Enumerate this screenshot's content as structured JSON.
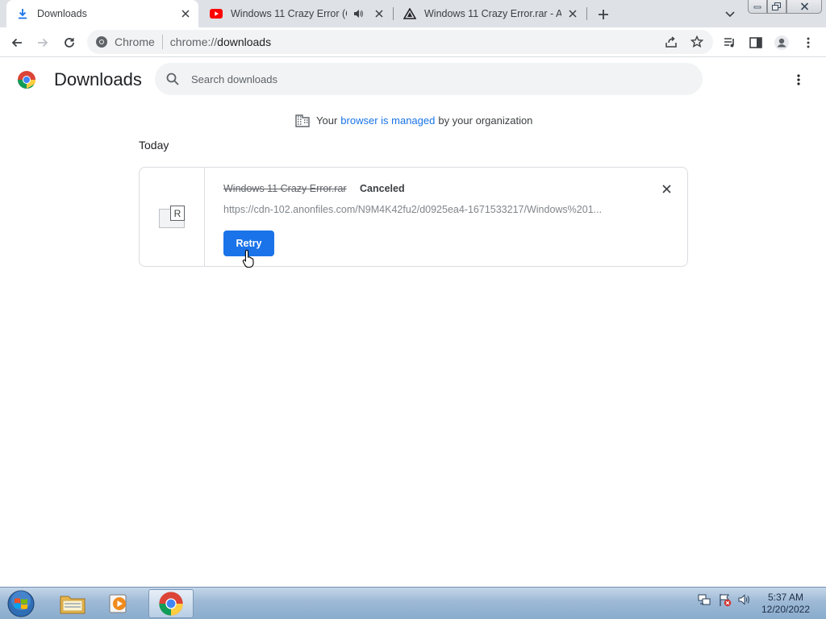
{
  "tabs": [
    {
      "title": "Downloads",
      "icon": "download-icon",
      "active": true
    },
    {
      "title": "Windows 11 Crazy Error (Có",
      "icon": "youtube-icon",
      "audio": true
    },
    {
      "title": "Windows 11 Crazy Error.rar - Anc",
      "icon": "anonfiles-icon"
    }
  ],
  "omnibox": {
    "site_label": "Chrome",
    "url_prefix": "chrome://",
    "url_host": "downloads"
  },
  "header": {
    "title": "Downloads",
    "search_placeholder": "Search downloads"
  },
  "managed_notice": {
    "prefix": "Your",
    "link": "browser is managed",
    "suffix": "by your organization"
  },
  "section_date": "Today",
  "download": {
    "file_name": "Windows 11 Crazy Error.rar",
    "status": "Canceled",
    "url": "https://cdn-102.anonfiles.com/N9M4K42fu2/d0925ea4-1671533217/Windows%201...",
    "retry_label": "Retry",
    "file_icon_letter": "R"
  },
  "taskbar": {
    "time": "5:37 AM",
    "date": "12/20/2022"
  },
  "colors": {
    "accent": "#1a73e8",
    "tabstrip": "#dee1e6"
  }
}
